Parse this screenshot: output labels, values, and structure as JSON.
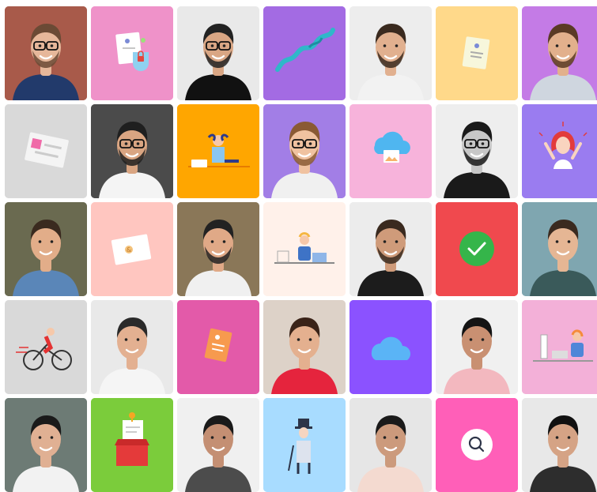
{
  "tiles": [
    {
      "kind": "photo",
      "bg": "#a85a4a",
      "shirt": "#223a6b",
      "skin": "#e6b79a",
      "hair": "#6b4a35",
      "glasses": true,
      "beard": true,
      "icon": "person-photo"
    },
    {
      "kind": "illus",
      "bg": "#ef92c9",
      "icon": "document-lock-icon"
    },
    {
      "kind": "photo",
      "bg": "#e9e9e9",
      "shirt": "#111111",
      "skin": "#d9a684",
      "hair": "#222222",
      "glasses": true,
      "beard": true,
      "icon": "person-photo"
    },
    {
      "kind": "illus",
      "bg": "#a36be3",
      "icon": "ribbon-icon"
    },
    {
      "kind": "photo",
      "bg": "#ededed",
      "shirt": "#f2f2f2",
      "skin": "#e1b08f",
      "hair": "#3a2a1f",
      "glasses": false,
      "beard": true,
      "icon": "person-photo"
    },
    {
      "kind": "illus",
      "bg": "#ffd98a",
      "icon": "document-icon"
    },
    {
      "kind": "photo",
      "bg": "#c47be6",
      "shirt": "#cfd6df",
      "skin": "#e2b08c",
      "hair": "#5a3a25",
      "glasses": false,
      "beard": true,
      "icon": "person-photo"
    },
    {
      "kind": "illus",
      "bg": "#d9d9d9",
      "icon": "card-icon"
    },
    {
      "kind": "photo",
      "bg": "#4b4b4b",
      "shirt": "#f4f4f4",
      "skin": "#d9a582",
      "hair": "#1f1f1f",
      "glasses": true,
      "beard": true,
      "icon": "person-photo"
    },
    {
      "kind": "illus",
      "bg": "#ffa600",
      "icon": "relaxing-person-icon"
    },
    {
      "kind": "photo",
      "bg": "#a27ee6",
      "shirt": "#f0f0f0",
      "skin": "#f0c2a0",
      "hair": "#8a5a34",
      "glasses": true,
      "beard": true,
      "icon": "person-photo"
    },
    {
      "kind": "illus",
      "bg": "#f7b3db",
      "icon": "cloud-image-icon"
    },
    {
      "kind": "photo",
      "bg": "#eeeeee",
      "shirt": "#1a1a1a",
      "skin": "#c7c7c7",
      "hair": "#1a1a1a",
      "glasses": true,
      "beard": true,
      "icon": "person-photo"
    },
    {
      "kind": "illus",
      "bg": "#9a7cf0",
      "icon": "excited-woman-icon"
    },
    {
      "kind": "photo",
      "bg": "#6a6a50",
      "shirt": "#5a86b8",
      "skin": "#e2ad89",
      "hair": "#3a2a1f",
      "glasses": false,
      "beard": false,
      "icon": "person-photo"
    },
    {
      "kind": "illus",
      "bg": "#ffc6c0",
      "icon": "card-badge-icon"
    },
    {
      "kind": "photo",
      "bg": "#8a7758",
      "shirt": "#f0f0f0",
      "skin": "#e0a987",
      "hair": "#222222",
      "glasses": false,
      "beard": true,
      "icon": "person-photo"
    },
    {
      "kind": "illus",
      "bg": "#fff1ea",
      "icon": "desk-worker-icon"
    },
    {
      "kind": "photo",
      "bg": "#ececec",
      "shirt": "#1c1c1c",
      "skin": "#cf9b7a",
      "hair": "#3a2a1f",
      "glasses": false,
      "beard": true,
      "icon": "person-photo"
    },
    {
      "kind": "illus",
      "bg": "#f0494e",
      "icon": "check-circle-icon"
    },
    {
      "kind": "photo",
      "bg": "#7fa6b0",
      "shirt": "#3a5a5a",
      "skin": "#e5b694",
      "hair": "#3a2a1f",
      "glasses": false,
      "beard": false,
      "icon": "person-photo"
    },
    {
      "kind": "illus",
      "bg": "#d9d9d9",
      "icon": "cyclist-icon"
    },
    {
      "kind": "photo",
      "bg": "#e9e9e9",
      "shirt": "#f5f5f5",
      "skin": "#e3b091",
      "hair": "#2a2a2a",
      "glasses": false,
      "beard": false,
      "icon": "person-photo"
    },
    {
      "kind": "illus",
      "bg": "#e35aa9",
      "icon": "document-orange-icon"
    },
    {
      "kind": "photo",
      "bg": "#ddd2c8",
      "shirt": "#e5243d",
      "skin": "#e4b08f",
      "hair": "#3a2318",
      "glasses": false,
      "beard": false,
      "icon": "person-photo"
    },
    {
      "kind": "illus",
      "bg": "#8b52ff",
      "icon": "cloud-icon"
    },
    {
      "kind": "photo",
      "bg": "#f0f0f0",
      "shirt": "#f3b8bf",
      "skin": "#c99072",
      "hair": "#141414",
      "glasses": false,
      "beard": false,
      "icon": "person-photo"
    },
    {
      "kind": "illus",
      "bg": "#f3b0d8",
      "icon": "computer-worker-icon"
    },
    {
      "kind": "photo",
      "bg": "#6d7b75",
      "shirt": "#f2f2f2",
      "skin": "#e0b093",
      "hair": "#1a1a1a",
      "glasses": false,
      "beard": false,
      "icon": "person-photo"
    },
    {
      "kind": "illus",
      "bg": "#7bcc3b",
      "icon": "box-document-icon"
    },
    {
      "kind": "photo",
      "bg": "#f0f0f0",
      "shirt": "#4c4c4c",
      "skin": "#c48f73",
      "hair": "#1a1a1a",
      "glasses": false,
      "beard": false,
      "icon": "person-photo"
    },
    {
      "kind": "illus",
      "bg": "#a8dcff",
      "icon": "gentleman-icon"
    },
    {
      "kind": "photo",
      "bg": "#e6e6e6",
      "shirt": "#f4dad0",
      "skin": "#cc9a7c",
      "hair": "#1a1a1a",
      "glasses": false,
      "beard": false,
      "icon": "person-photo"
    },
    {
      "kind": "illus",
      "bg": "#ff5fb8",
      "icon": "search-icon"
    },
    {
      "kind": "photo",
      "bg": "#e8e8e8",
      "shirt": "#2d2d2d",
      "skin": "#d5a385",
      "hair": "#111111",
      "glasses": false,
      "beard": false,
      "icon": "person-photo"
    }
  ]
}
